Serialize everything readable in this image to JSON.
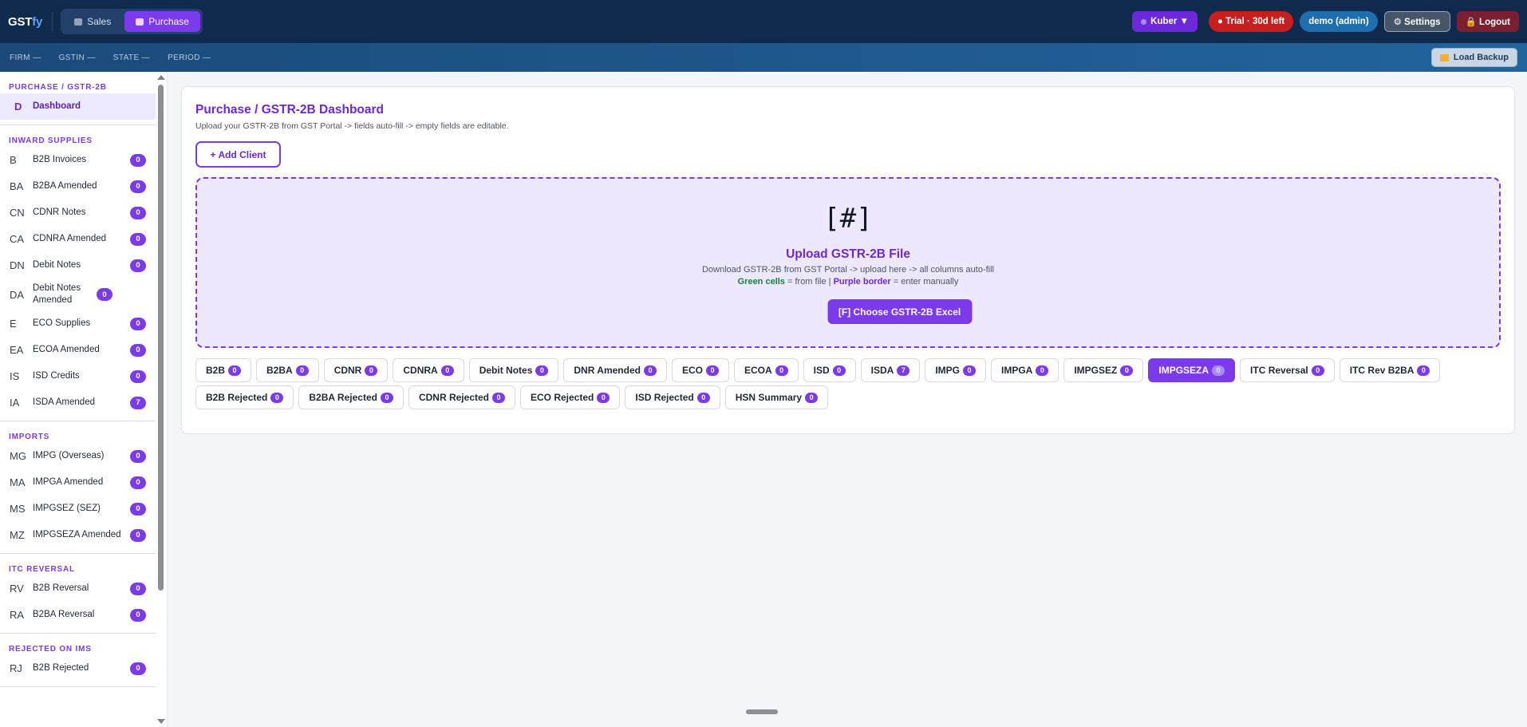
{
  "app": {
    "logo_main": "GST",
    "logo_suffix": "fy",
    "modes": [
      {
        "label": "Sales",
        "active": false
      },
      {
        "label": "Purchase",
        "active": true
      }
    ],
    "kuber_label": "Kuber ▼",
    "trial_label": "● Trial · 30d left",
    "user_label": "demo (admin)",
    "settings_label": "⚙ Settings",
    "logout_label": "🔒 Logout"
  },
  "infobar": {
    "firm": "FIRM —",
    "gstin": "GSTIN —",
    "state": "STATE —",
    "period": "PERIOD —",
    "load_backup": "Load Backup"
  },
  "sidebar": {
    "sections": [
      {
        "title": "PURCHASE / GSTR-2B",
        "items": [
          {
            "code": "D",
            "label": "Dashboard",
            "active": true
          }
        ]
      },
      {
        "title": "INWARD SUPPLIES",
        "items": [
          {
            "code": "B",
            "label": "B2B Invoices",
            "count": "0"
          },
          {
            "code": "BA",
            "label": "B2BA Amended",
            "count": "0"
          },
          {
            "code": "CN",
            "label": "CDNR Notes",
            "count": "0"
          },
          {
            "code": "CA",
            "label": "CDNRA Amended",
            "count": "0"
          },
          {
            "code": "DN",
            "label": "Debit Notes",
            "count": "0"
          },
          {
            "code": "DA",
            "label": "Debit Notes Amended",
            "count": "0"
          },
          {
            "code": "E",
            "label": "ECO Supplies",
            "count": "0"
          },
          {
            "code": "EA",
            "label": "ECOA Amended",
            "count": "0"
          },
          {
            "code": "IS",
            "label": "ISD Credits",
            "count": "0"
          },
          {
            "code": "IA",
            "label": "ISDA Amended",
            "count": "7"
          }
        ]
      },
      {
        "title": "IMPORTS",
        "items": [
          {
            "code": "MG",
            "label": "IMPG (Overseas)",
            "count": "0"
          },
          {
            "code": "MA",
            "label": "IMPGA Amended",
            "count": "0"
          },
          {
            "code": "MS",
            "label": "IMPGSEZ (SEZ)",
            "count": "0"
          },
          {
            "code": "MZ",
            "label": "IMPGSEZA Amended",
            "count": "0"
          }
        ]
      },
      {
        "title": "ITC REVERSAL",
        "items": [
          {
            "code": "RV",
            "label": "B2B Reversal",
            "count": "0"
          },
          {
            "code": "RA",
            "label": "B2BA Reversal",
            "count": "0"
          }
        ]
      },
      {
        "title": "REJECTED ON IMS",
        "items": [
          {
            "code": "RJ",
            "label": "B2B Rejected",
            "count": "0"
          }
        ]
      }
    ]
  },
  "main": {
    "title": "Purchase / GSTR-2B Dashboard",
    "subtitle": "Upload your GSTR-2B from GST Portal -> fields auto-fill -> empty fields are editable.",
    "add_client": "+ Add Client",
    "upload": {
      "icon_text": "[#]",
      "title": "Upload GSTR-2B File",
      "line1": "Download GSTR-2B from GST Portal -> upload here -> all columns auto-fill",
      "green_label": "Green cells",
      "green_text": " = from file | ",
      "purple_label": "Purple border",
      "purple_text": " = enter manually",
      "choose_button": "[F] Choose GSTR-2B Excel"
    },
    "tab_rows": [
      [
        {
          "label": "B2B",
          "count": "0"
        },
        {
          "label": "B2BA",
          "count": "0"
        },
        {
          "label": "CDNR",
          "count": "0"
        },
        {
          "label": "CDNRA",
          "count": "0"
        },
        {
          "label": "Debit Notes",
          "count": "0"
        },
        {
          "label": "DNR Amended",
          "count": "0"
        },
        {
          "label": "ECO",
          "count": "0"
        },
        {
          "label": "ECOA",
          "count": "0"
        },
        {
          "label": "ISD",
          "count": "0"
        },
        {
          "label": "ISDA",
          "count": "7"
        },
        {
          "label": "IMPG",
          "count": "0"
        },
        {
          "label": "IMPGA",
          "count": "0"
        },
        {
          "label": "IMPGSEZ",
          "count": "0"
        },
        {
          "label": "IMPGSEZA",
          "count": "0",
          "active": true
        },
        {
          "label": "ITC Reversal",
          "count": "0"
        },
        {
          "label": "ITC Rev B2BA",
          "count": "0"
        }
      ],
      [
        {
          "label": "B2B Rejected",
          "count": "0"
        },
        {
          "label": "B2BA Rejected",
          "count": "0"
        },
        {
          "label": "CDNR Rejected",
          "count": "0"
        },
        {
          "label": "ECO Rejected",
          "count": "0"
        },
        {
          "label": "ISD Rejected",
          "count": "0"
        },
        {
          "label": "HSN Summary",
          "count": "0"
        }
      ]
    ]
  },
  "colors": {
    "accent": "#7c3aed",
    "topbar": "#0f2a4d",
    "trial": "#c81e1e",
    "user": "#1e6fb0"
  }
}
